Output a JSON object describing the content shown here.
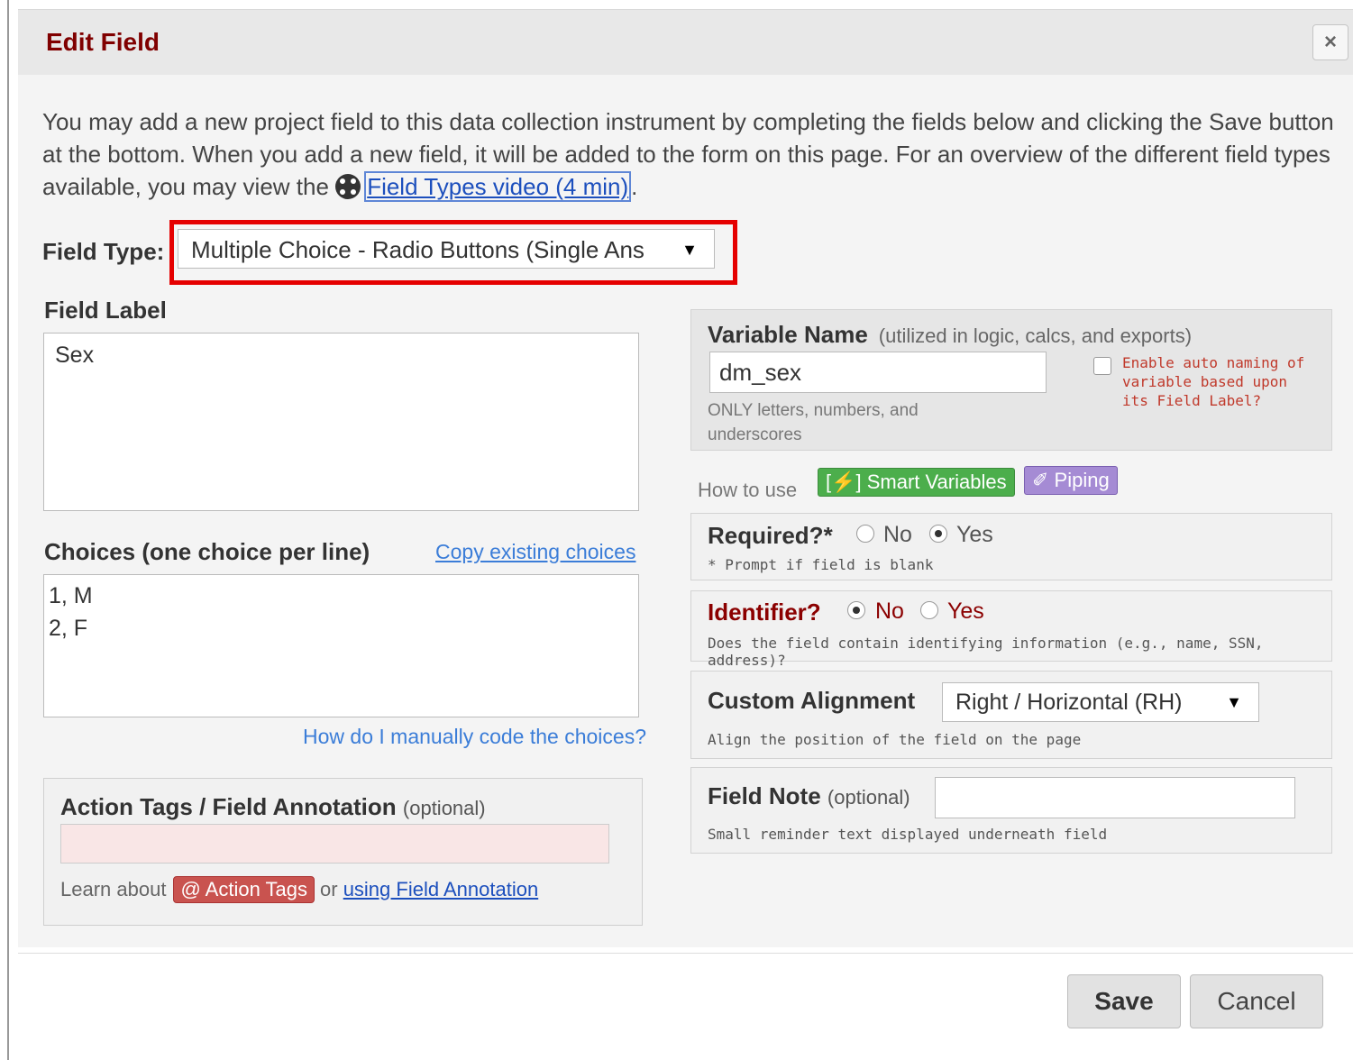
{
  "dialog": {
    "title": "Edit Field",
    "close_icon": "×"
  },
  "intro": {
    "text": "You may add a new project field to this data collection instrument by completing the fields below and clicking the Save button at the bottom. When you add a new field, it will be added to the form on this page. For an overview of the different field types available, you may view the",
    "video_link": "Field Types video (4 min)",
    "trailing": "."
  },
  "field_type": {
    "label": "Field Type:",
    "value": "Multiple Choice - Radio Buttons (Single Ans",
    "arrow": "▼",
    "highlight_color": "#e50000"
  },
  "field_label": {
    "label": "Field Label",
    "value": "Sex"
  },
  "choices": {
    "label": "Choices (one choice per line)",
    "copy_link": "Copy existing choices",
    "value": "1, M\n2, F",
    "help_link": "How do I manually code the choices?"
  },
  "annotation": {
    "title": "Action Tags / Field Annotation",
    "optional": "(optional)",
    "learn_prefix": "Learn about",
    "action_tags_badge": "@ Action Tags",
    "or": "or",
    "link": "using Field Annotation"
  },
  "variable": {
    "title": "Variable Name",
    "hint": "(utilized in logic, calcs, and exports)",
    "value": "dm_sex",
    "help": "ONLY letters, numbers, and underscores",
    "auto_naming": "Enable auto naming of variable based upon its Field Label?",
    "auto_naming_checked": false
  },
  "howto": {
    "prefix": "How to use",
    "smart_variables": "[⚡] Smart Variables",
    "piping": "✐ Piping"
  },
  "required": {
    "title": "Required?*",
    "no": "No",
    "yes": "Yes",
    "selected": "Yes",
    "note": "* Prompt if field is blank"
  },
  "identifier": {
    "title": "Identifier?",
    "no": "No",
    "yes": "Yes",
    "selected": "No",
    "note": "Does the field contain identifying information (e.g., name, SSN, address)?"
  },
  "alignment": {
    "title": "Custom Alignment",
    "value": "Right / Horizontal (RH)",
    "arrow": "▼",
    "note": "Align the position of the field on the page"
  },
  "field_note": {
    "title": "Field Note",
    "optional": "(optional)",
    "value": "",
    "note": "Small reminder text displayed underneath field"
  },
  "footer": {
    "save": "Save",
    "cancel": "Cancel"
  }
}
